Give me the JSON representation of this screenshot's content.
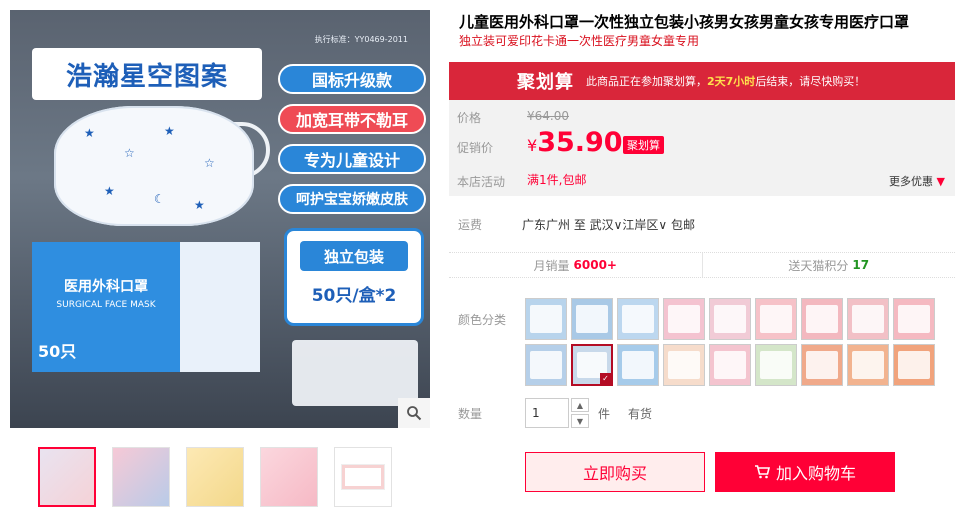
{
  "gallery": {
    "main_image": {
      "headline": "浩瀚星空图案",
      "standard": "执行标准：YY0469-2011",
      "features": [
        "国标升级款",
        "加宽耳带不勒耳",
        "专为儿童设计",
        "呵护宝宝娇嫩皮肤"
      ],
      "pack_label": "独立包装",
      "pack_count": "50只/盒*2",
      "box_title": "医用外科口罩",
      "box_subtitle": "SURGICAL FACE MASK",
      "box_count": "50只"
    },
    "zoom_icon": "magnifier-icon",
    "thumbnails": [
      "thumb-1",
      "thumb-2",
      "thumb-3",
      "thumb-4",
      "thumb-5"
    ]
  },
  "product": {
    "title": "儿童医用外科口罩一次性独立包装小孩男女孩男童女孩专用医疗口罩",
    "subtitle": "独立装可爱印花卡通一次性医疗男童女童专用"
  },
  "juhuasuan": {
    "logo": "聚划算",
    "msg_prefix": "此商品正在参加聚划算，",
    "time_left": "2天7小时",
    "msg_suffix": "后结束，请尽快购买！"
  },
  "price": {
    "label_price": "价格",
    "original": "¥64.00",
    "label_promo": "促销价",
    "currency": "¥",
    "current": "35.90",
    "tag": "聚划算",
    "label_activity": "本店活动",
    "activity": "满1件,包邮",
    "more_offers": "更多优惠"
  },
  "shipping": {
    "label": "运费",
    "text": "广东广州 至 武汉∨江岸区∨ 包邮"
  },
  "stats": {
    "monthly_label": "月销量",
    "monthly_value": "6000+",
    "points_label": "送天猫积分",
    "points_value": "17"
  },
  "colors": {
    "label": "颜色分类",
    "swatches": [
      "#b8d4ec",
      "#a9c9e6",
      "#bcd7ef",
      "#f4c3d0",
      "#f1cbd6",
      "#f6c2c8",
      "#f3b8bf",
      "#f2c0c6",
      "#f5b9c1",
      "#b5cfe9",
      "#c8d9ea",
      "#a6cbea",
      "#f6dccb",
      "#f4c4cf",
      "#d4e6c9",
      "#f0a98a",
      "#f2b38f",
      "#f1a37c"
    ],
    "selected_index": 10
  },
  "quantity": {
    "label": "数量",
    "value": "1",
    "unit": "件",
    "stock": "有货"
  },
  "actions": {
    "buy_now": "立即购买",
    "add_to_cart": "加入购物车"
  }
}
